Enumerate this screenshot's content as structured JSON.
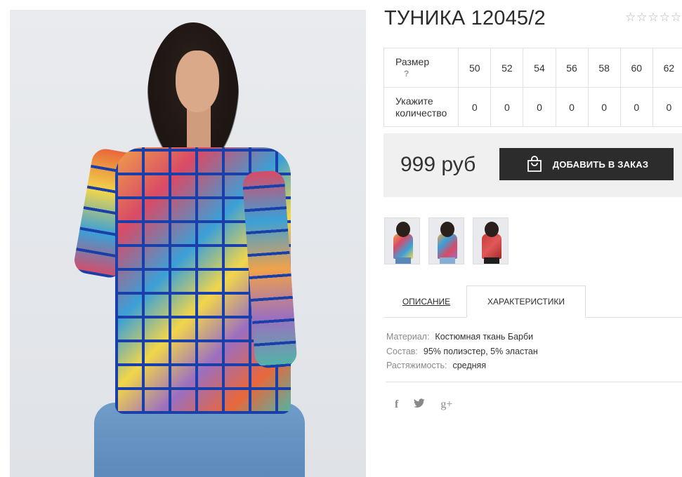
{
  "product": {
    "title": "ТУНИКА 12045/2",
    "rating_stars": [
      "☆",
      "☆",
      "☆",
      "☆",
      "☆"
    ],
    "rating_value": 0,
    "rating_max": 5
  },
  "size_table": {
    "size_label": "Размер",
    "help_mark": "?",
    "sizes": [
      "50",
      "52",
      "54",
      "56",
      "58",
      "60",
      "62"
    ],
    "quantity_label": "Укажите количество",
    "quantities": [
      "0",
      "0",
      "0",
      "0",
      "0",
      "0",
      "0"
    ]
  },
  "purchase": {
    "price": "999 руб",
    "add_button_label": "ДОБАВИТЬ В ЗАКАЗ",
    "button_icon": "shopping-bag-icon"
  },
  "tabs": {
    "description_label": "ОПИСАНИЕ",
    "characteristics_label": "ХАРАКТЕРИСТИКИ",
    "active": "characteristics"
  },
  "specs": [
    {
      "label": "Материал:",
      "value": "Костюмная ткань Барби"
    },
    {
      "label": "Состав:",
      "value": "95% полиэстер, 5% эластан"
    },
    {
      "label": "Растяжимость:",
      "value": "средняя"
    }
  ],
  "social": {
    "facebook": "f",
    "twitter": "🐦",
    "google_plus": "g+"
  },
  "colors": {
    "button_bg": "#2c2c2c",
    "price_block_bg": "#f0f0f0",
    "star_color": "#b5b5b5"
  }
}
